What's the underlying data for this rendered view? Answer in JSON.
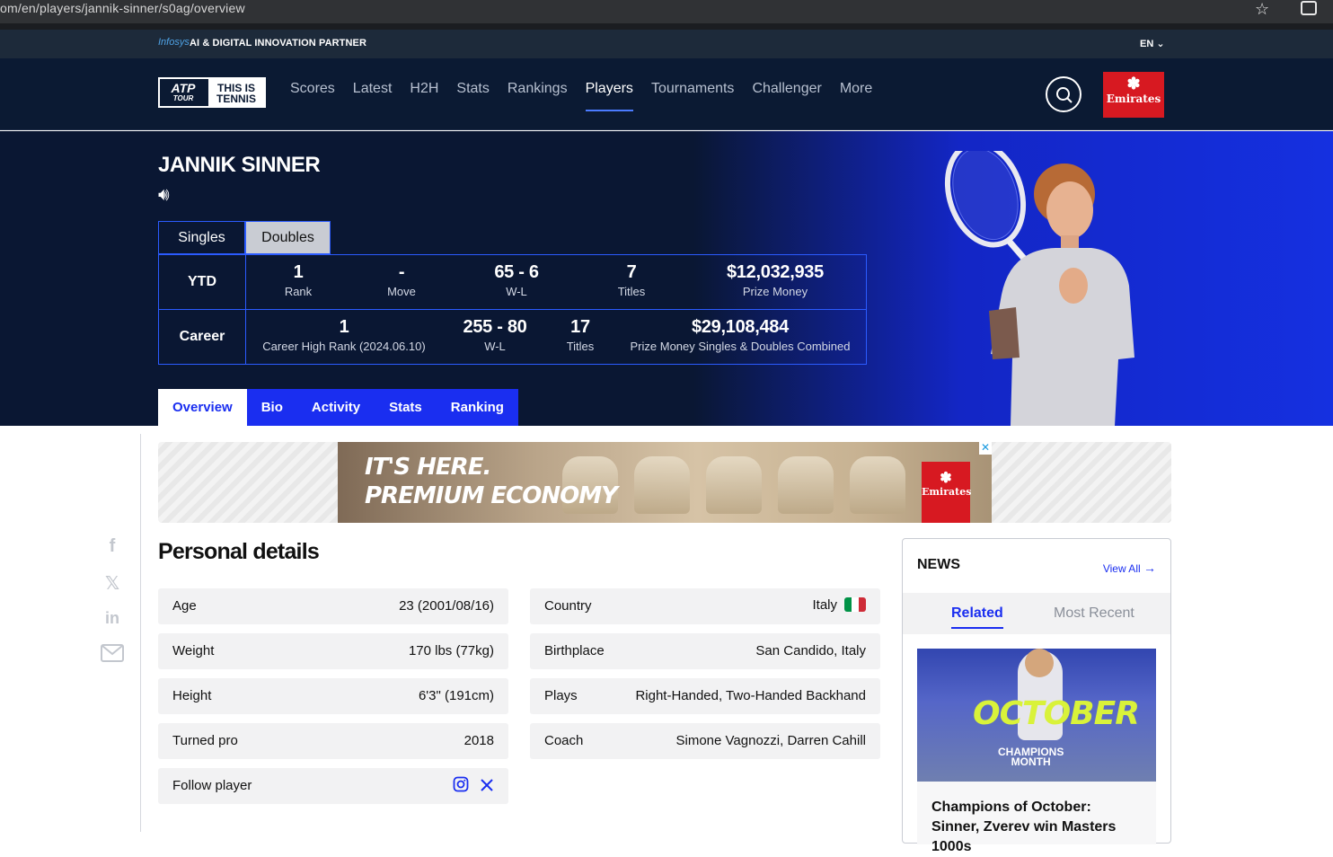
{
  "browser": {
    "url": "om/en/players/jannik-sinner/s0ag/overview"
  },
  "infosys_bar": {
    "logo": "Infosys",
    "tagline": "AI & DIGITAL INNOVATION PARTNER",
    "language": "EN"
  },
  "nav": {
    "logo_atp": "ATP",
    "logo_tour": "TOUR",
    "logo_tagline_1": "THIS IS",
    "logo_tagline_2": "TENNIS",
    "items": [
      "Scores",
      "Latest",
      "H2H",
      "Stats",
      "Rankings",
      "Players",
      "Tournaments",
      "Challenger",
      "More"
    ],
    "active": "Players",
    "sponsor": "Emirates"
  },
  "player": {
    "name": "JANNIK SINNER",
    "format_tabs": [
      "Singles",
      "Doubles"
    ],
    "active_format": "Doubles",
    "ytd": {
      "label": "YTD",
      "rank": "1",
      "rank_label": "Rank",
      "move": "-",
      "move_label": "Move",
      "wl": "65 - 6",
      "wl_label": "W-L",
      "titles": "7",
      "titles_label": "Titles",
      "prize": "$12,032,935",
      "prize_label": "Prize Money"
    },
    "career": {
      "label": "Career",
      "high_rank": "1",
      "high_rank_label": "Career High Rank (2024.06.10)",
      "wl": "255 - 80",
      "wl_label": "W-L",
      "titles": "17",
      "titles_label": "Titles",
      "prize": "$29,108,484",
      "prize_label": "Prize Money Singles & Doubles Combined"
    }
  },
  "sub_tabs": [
    "Overview",
    "Bio",
    "Activity",
    "Stats",
    "Ranking"
  ],
  "active_sub_tab": "Overview",
  "ad": {
    "line1": "IT'S HERE.",
    "line2": "PREMIUM ECONOMY",
    "brand": "Emirates",
    "close": "✕"
  },
  "personal_details": {
    "title": "Personal details",
    "left": [
      {
        "key": "Age",
        "value": "23 (2001/08/16)"
      },
      {
        "key": "Weight",
        "value": "170 lbs (77kg)"
      },
      {
        "key": "Height",
        "value": "6'3\" (191cm)"
      },
      {
        "key": "Turned pro",
        "value": "2018"
      },
      {
        "key": "Follow player",
        "value": ""
      }
    ],
    "right": [
      {
        "key": "Country",
        "value": "Italy"
      },
      {
        "key": "Birthplace",
        "value": "San Candido, Italy"
      },
      {
        "key": "Plays",
        "value": "Right-Handed, Two-Handed Backhand"
      },
      {
        "key": "Coach",
        "value": "Simone Vagnozzi, Darren Cahill"
      }
    ]
  },
  "news": {
    "title": "NEWS",
    "view_all": "View All",
    "tabs": [
      "Related",
      "Most Recent"
    ],
    "active_tab": "Related",
    "thumb_word": "OCTOBER",
    "thumb_sub_1": "CHAMPIONS",
    "thumb_sub_2": "MONTH",
    "headline": "Champions of October: Sinner, Zverev win Masters 1000s"
  },
  "colors": {
    "navy": "#0b1a33",
    "accent_blue": "#1a2ef0",
    "emirates_red": "#d71921"
  }
}
